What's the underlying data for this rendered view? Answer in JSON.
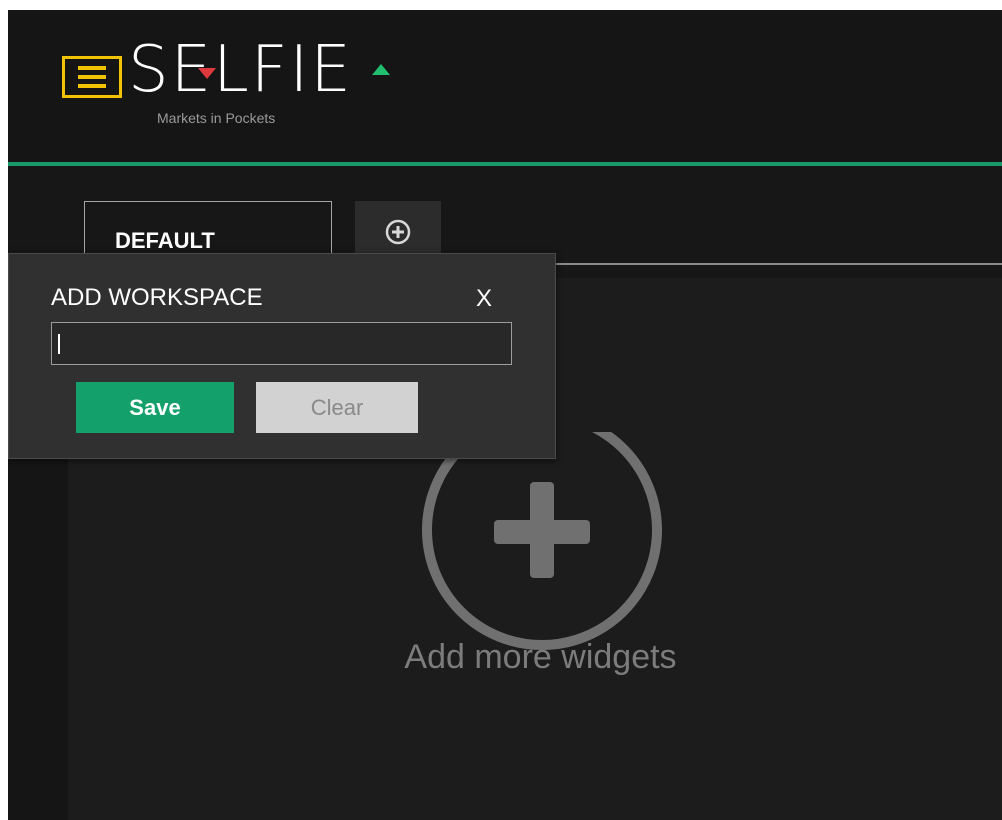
{
  "header": {
    "logo_text": "SELFIE",
    "tagline": "Markets in Pockets",
    "accent_color": "#1a9a6a",
    "menu_color": "#f2c300",
    "down_arrow_color": "#e0393d",
    "up_arrow_color": "#1fbf6f"
  },
  "tabs": {
    "items": [
      {
        "label": "DEFAULT"
      }
    ],
    "add_icon": "plus-circle-icon"
  },
  "popup": {
    "title": "ADD WORKSPACE",
    "close_label": "X",
    "input_value": "",
    "save_label": "Save",
    "clear_label": "Clear"
  },
  "main": {
    "add_widgets_icon": "plus-circle-icon",
    "add_widgets_label": "Add more widgets"
  }
}
